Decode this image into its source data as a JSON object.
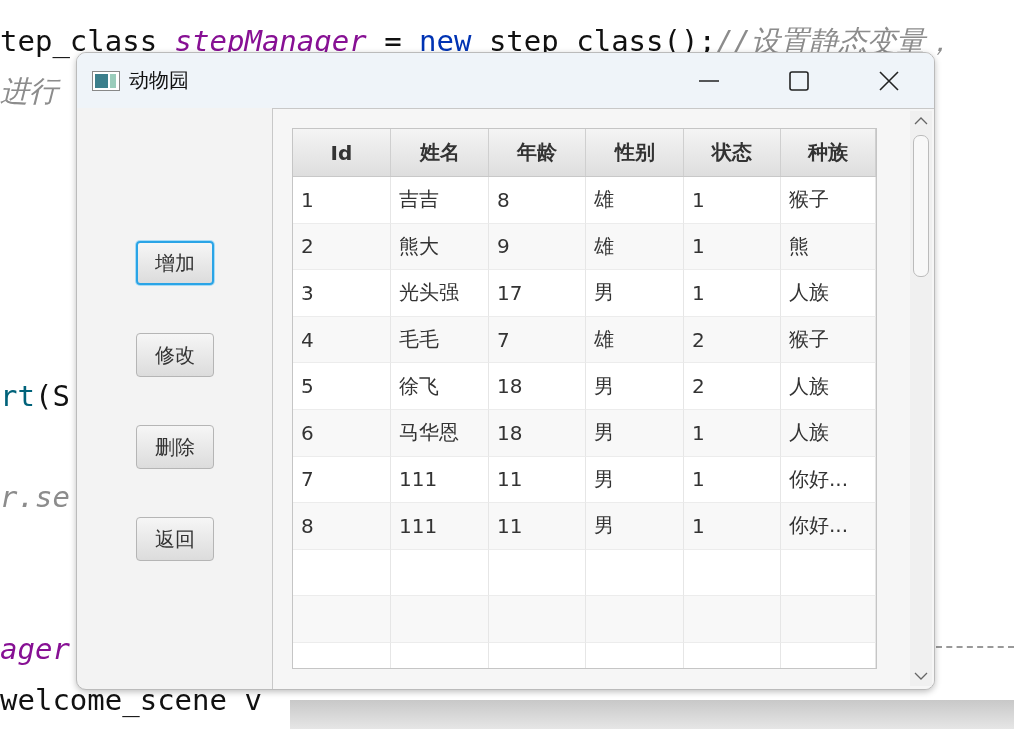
{
  "editor": {
    "lines": [
      {
        "segments": [
          {
            "kind": "plain",
            "text": "tep_class "
          },
          {
            "kind": "field",
            "text": "stepManager"
          },
          {
            "kind": "plain",
            "text": " = "
          },
          {
            "kind": "keyword",
            "text": "new"
          },
          {
            "kind": "plain",
            "text": " step class();"
          },
          {
            "kind": "comment",
            "text": "//设置静态变量，"
          }
        ]
      },
      {
        "segments": [
          {
            "kind": "comment",
            "text": "进行"
          }
        ]
      },
      {
        "segments": [
          {
            "kind": "method",
            "text": "rt"
          },
          {
            "kind": "plain",
            "text": "(S"
          }
        ]
      },
      {
        "segments": [
          {
            "kind": "comment",
            "text": "r.se"
          }
        ]
      },
      {
        "segments": [
          {
            "kind": "field",
            "text": "ager"
          }
        ]
      },
      {
        "segments": [
          {
            "kind": "plain",
            "text": " welcome_scene v"
          }
        ]
      }
    ]
  },
  "window": {
    "title": "动物园"
  },
  "buttons": [
    {
      "label": "增加",
      "focused": true
    },
    {
      "label": "修改",
      "focused": false
    },
    {
      "label": "删除",
      "focused": false
    },
    {
      "label": "返回",
      "focused": false
    }
  ],
  "table": {
    "columns": [
      "Id",
      "姓名",
      "年龄",
      "性别",
      "状态",
      "种族"
    ],
    "rows": [
      [
        "1",
        "吉吉",
        "8",
        "雄",
        "1",
        "猴子"
      ],
      [
        "2",
        "熊大",
        "9",
        "雄",
        "1",
        "熊"
      ],
      [
        "3",
        "光头强",
        "17",
        "男",
        "1",
        "人族"
      ],
      [
        "4",
        "毛毛",
        "7",
        "雄",
        "2",
        "猴子"
      ],
      [
        "5",
        "徐飞",
        "18",
        "男",
        "2",
        "人族"
      ],
      [
        "6",
        "马华恩",
        "18",
        "男",
        "1",
        "人族"
      ],
      [
        "7",
        "111",
        "11",
        "男",
        "1",
        "你好..."
      ],
      [
        "8",
        "111",
        "11",
        "男",
        "1",
        "你好..."
      ]
    ]
  }
}
